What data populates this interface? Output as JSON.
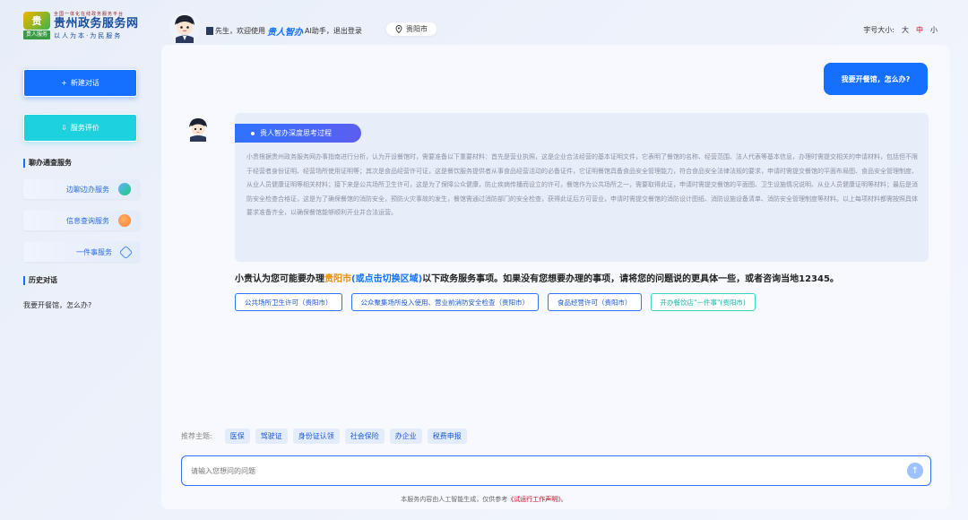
{
  "header": {
    "logo_small": "全国一体化在线政务服务平台",
    "logo_title": "贵州政务服务网",
    "logo_sub": "以人为本·为民服务",
    "logo_badge": "贵人服务",
    "greeting_prefix": "先生，欢迎使用",
    "brand": "贵人智办",
    "greeting_suffix": "AI助手，退出登录",
    "city": "贵阳市",
    "font_size_label": "字号大小:",
    "font_sizes": [
      "大",
      "中",
      "小"
    ]
  },
  "sidebar": {
    "new_chat": "新建对话",
    "rating": "服务评价",
    "channels_title": "聊办通查服务",
    "channels": [
      {
        "label": "边聊边办服务",
        "icon": "chat-service-icon"
      },
      {
        "label": "信息查询服务",
        "icon": "search-service-icon"
      },
      {
        "label": "一件事服务",
        "icon": "one-thing-icon"
      }
    ],
    "history_title": "历史对话",
    "history": [
      "我要开餐馆，怎么办?"
    ]
  },
  "chat": {
    "user_message": "我要开餐馆，怎么办?",
    "think_tag": "贵人智办深度思考过程",
    "think_text": "小贵根据贵州政务服务网办事指南进行分析，认为开设餐馆时，需要准备以下重要材料：首先是营业执照，这是企业合法经营的基本证明文件，它表明了餐馆的名称、经营范围、法人代表等基本信息，办理时需提交相关的申请材料，包括但不限于经营者身份证明、经营场所使用证明等；其次是食品经营许可证，这是餐饮服务提供者从事食品经营活动的必备证件，它证明餐馆具备食品安全管理能力，符合食品安全法律法规的要求，申请时需提交餐馆的平面布局图、食品安全管理制度、从业人员健康证明等相关材料；接下来是公共场所卫生许可，这是为了保障公众健康，防止疾病传播而设立的许可，餐馆作为公共场所之一，需要取得此证，申请时需提交餐馆的平面图、卫生设施情况说明、从业人员健康证明等材料；最后是消防安全检查合格证，这是为了确保餐馆的消防安全，预防火灾事故的发生，餐馆需通过消防部门的安全检查，获得此证后方可营业，申请时需提交餐馆的消防设计图纸、消防设施设备清单、消防安全管理制度等材料。以上每项材料都需按照具体要求准备齐全，以确保餐馆能够顺利开业并合法运营。",
    "answer_prefix": "小贵认为您可能要办理",
    "answer_city": "贵阳市",
    "answer_switch": "(或点击切换区域)",
    "answer_suffix": "以下政务服务事项。如果没有您想要办理的事项，请将您的问题说的更具体一些，或者咨询当地12345。",
    "chips": [
      {
        "label": "公共场所卫生许可（贵阳市）",
        "style": "blue"
      },
      {
        "label": "公众聚集场所投入使用、营业前消防安全检查（贵阳市）",
        "style": "blue"
      },
      {
        "label": "食品经营许可（贵阳市）",
        "style": "blue"
      },
      {
        "label": "开办餐饮店\"一件事\"(贵阳市)",
        "style": "green"
      }
    ]
  },
  "composer": {
    "topics_label": "推荐主题:",
    "topics": [
      "医保",
      "驾驶证",
      "身份证认领",
      "社会保险",
      "办企业",
      "税费申报"
    ],
    "placeholder": "请输入您想问的问题"
  },
  "footer": {
    "prefix": "本服务内容由人工智能生成，仅供参考",
    "link": "《试运行工作声明》",
    "suffix": "。"
  },
  "colors": {
    "primary": "#1570ff",
    "cyan": "#1ed1df",
    "accent_orange": "#f08c00",
    "accent_red": "#d0021b"
  }
}
